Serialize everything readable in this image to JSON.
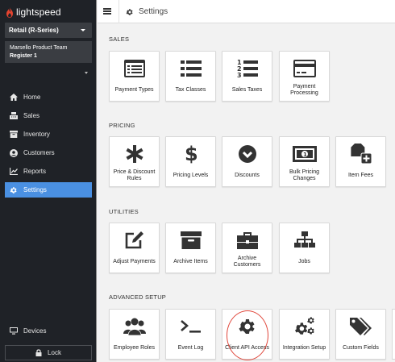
{
  "app": {
    "logo_text": "lightspeed"
  },
  "sidebar": {
    "product": "Retail (R-Series)",
    "store": {
      "team": "Marsello Product Team",
      "register": "Register 1"
    },
    "items": [
      {
        "label": "Home",
        "icon": "home-icon"
      },
      {
        "label": "Sales",
        "icon": "register-icon"
      },
      {
        "label": "Inventory",
        "icon": "inventory-icon"
      },
      {
        "label": "Customers",
        "icon": "customer-icon"
      },
      {
        "label": "Reports",
        "icon": "chart-icon"
      },
      {
        "label": "Settings",
        "icon": "gear-icon",
        "active": true
      }
    ],
    "devices": {
      "label": "Devices",
      "icon": "monitor-icon"
    },
    "lock": {
      "label": "Lock",
      "icon": "lock-icon"
    }
  },
  "header": {
    "title": "Settings"
  },
  "sections": {
    "sales": {
      "label": "SALES",
      "tiles": [
        {
          "label": "Payment Types",
          "icon": "payment-types-icon"
        },
        {
          "label": "Tax Classes",
          "icon": "list-icon"
        },
        {
          "label": "Sales Taxes",
          "icon": "numbered-list-icon"
        },
        {
          "label": "Payment Processing",
          "icon": "credit-card-icon"
        }
      ]
    },
    "pricing": {
      "label": "PRICING",
      "tiles": [
        {
          "label": "Price & Discount Rules",
          "icon": "asterisk-icon"
        },
        {
          "label": "Pricing Levels",
          "icon": "dollar-icon"
        },
        {
          "label": "Discounts",
          "icon": "chevron-circle-icon"
        },
        {
          "label": "Bulk Pricing Changes",
          "icon": "money-bill-icon"
        },
        {
          "label": "Item Fees",
          "icon": "tag-plus-icon"
        }
      ]
    },
    "utilities": {
      "label": "UTILITIES",
      "tiles": [
        {
          "label": "Adjust Payments",
          "icon": "edit-icon"
        },
        {
          "label": "Archive Items",
          "icon": "archive-icon"
        },
        {
          "label": "Archive Customers",
          "icon": "briefcase-icon"
        },
        {
          "label": "Jobs",
          "icon": "sitemap-icon"
        }
      ]
    },
    "advanced": {
      "label": "ADVANCED SETUP",
      "tiles": [
        {
          "label": "Employee Roles",
          "icon": "users-icon"
        },
        {
          "label": "Event Log",
          "icon": "terminal-icon"
        },
        {
          "label": "Client API Access",
          "icon": "gear-icon"
        },
        {
          "label": "Integration Setup",
          "icon": "gears-icon"
        },
        {
          "label": "Custom Fields",
          "icon": "tags-icon"
        }
      ]
    }
  },
  "colors": {
    "sidebar_bg": "#1f2227",
    "active": "#4a90e2",
    "logo_red": "#e5432f",
    "highlight": "#e0463a"
  }
}
